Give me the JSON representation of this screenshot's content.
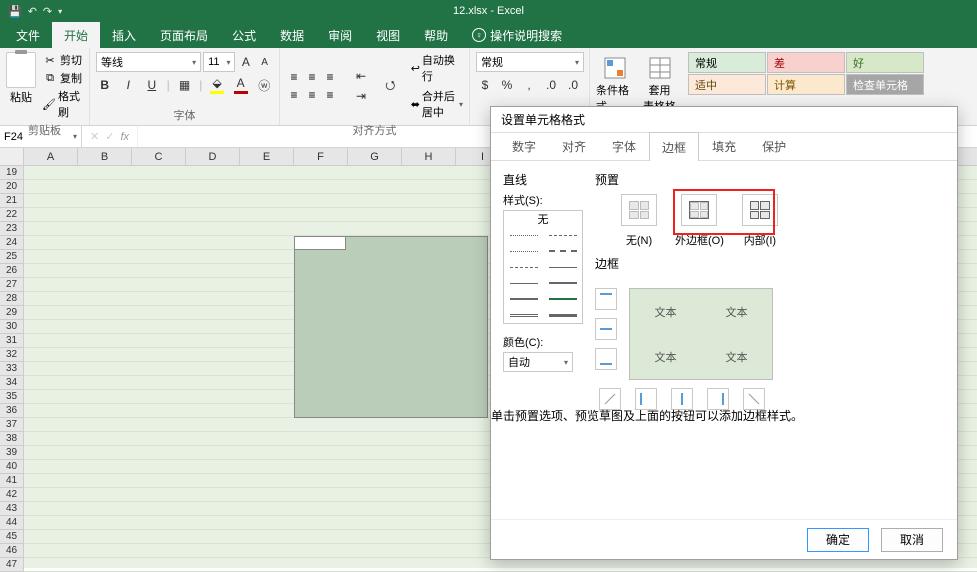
{
  "title": "12.xlsx - Excel",
  "qat": {
    "undo": "↶",
    "redo": "↷"
  },
  "tabs": {
    "file": "文件",
    "home": "开始",
    "insert": "插入",
    "layout": "页面布局",
    "formulas": "公式",
    "data": "数据",
    "review": "审阅",
    "view": "视图",
    "help": "帮助",
    "tell": "操作说明搜索"
  },
  "ribbon": {
    "clipboard": {
      "label": "剪贴板",
      "paste": "粘贴",
      "cut": "剪切",
      "copy": "复制",
      "painter": "格式刷"
    },
    "font": {
      "label": "字体",
      "name": "等线",
      "size": "11",
      "bold": "B",
      "italic": "I",
      "underline": "U"
    },
    "align": {
      "label": "对齐方式",
      "wrap": "自动换行",
      "merge": "合并后居中"
    },
    "number": {
      "label": "",
      "general": "常规"
    },
    "styles": {
      "cond": "条件格式",
      "table": "套用\n表格格式",
      "cells": {
        "normal": "常规",
        "bad": "差",
        "good": "好",
        "neutral": "适中",
        "calc": "计算",
        "check": "检查单元格"
      }
    }
  },
  "nameBox": "F24",
  "fx": "fx",
  "columns": [
    "A",
    "B",
    "C",
    "D",
    "E",
    "F",
    "G",
    "H",
    "I"
  ],
  "rowStart": 19,
  "rowEnd": 47,
  "dialog": {
    "title": "设置单元格格式",
    "tabs": {
      "number": "数字",
      "align": "对齐",
      "font": "字体",
      "border": "边框",
      "fill": "填充",
      "protect": "保护"
    },
    "line": {
      "section": "直线",
      "styleLabel": "样式(S):",
      "none": "无",
      "colorLabel": "颜色(C):",
      "colorAuto": "自动"
    },
    "preset": {
      "section": "预置",
      "none": "无(N)",
      "outline": "外边框(O)",
      "inside": "内部(I)"
    },
    "border": {
      "section": "边框",
      "text": "文本"
    },
    "hint": "单击预置选项、预览草图及上面的按钮可以添加边框样式。",
    "ok": "确定",
    "cancel": "取消"
  }
}
